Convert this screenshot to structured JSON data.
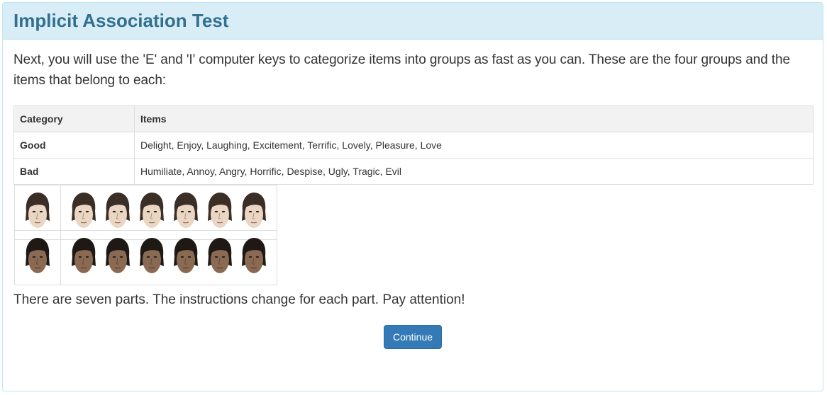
{
  "header": {
    "title": "Implicit Association Test"
  },
  "intro_text": "Next, you will use the 'E' and 'I' computer keys to categorize items into groups as fast as you can. These are the four groups and the items that belong to each:",
  "table": {
    "columns": [
      "Category",
      "Items"
    ],
    "rows": [
      {
        "category": "Good",
        "items": "Delight, Enjoy, Laughing, Excitement, Terrific, Lovely, Pleasure, Love"
      },
      {
        "category": "Bad",
        "items": "Humiliate, Annoy, Angry, Horrific, Despise, Ugly, Tragic, Evil"
      }
    ],
    "face_groups": [
      {
        "category_image": "light-skin-face",
        "item_images": [
          "light-skin-face",
          "light-skin-face",
          "light-skin-face",
          "light-skin-face",
          "light-skin-face",
          "light-skin-face"
        ],
        "skin": "#ead6c2",
        "hair": "#3a2e26"
      },
      {
        "category_image": "dark-skin-face",
        "item_images": [
          "dark-skin-face",
          "dark-skin-face",
          "dark-skin-face",
          "dark-skin-face",
          "dark-skin-face",
          "dark-skin-face"
        ],
        "skin": "#8a6a52",
        "hair": "#1e1915"
      }
    ]
  },
  "outro_text": "There are seven parts. The instructions change for each part. Pay attention!",
  "continue_label": "Continue",
  "colors": {
    "heading_bg": "#d9edf7",
    "heading_text": "#31708f",
    "button": "#337ab7"
  }
}
